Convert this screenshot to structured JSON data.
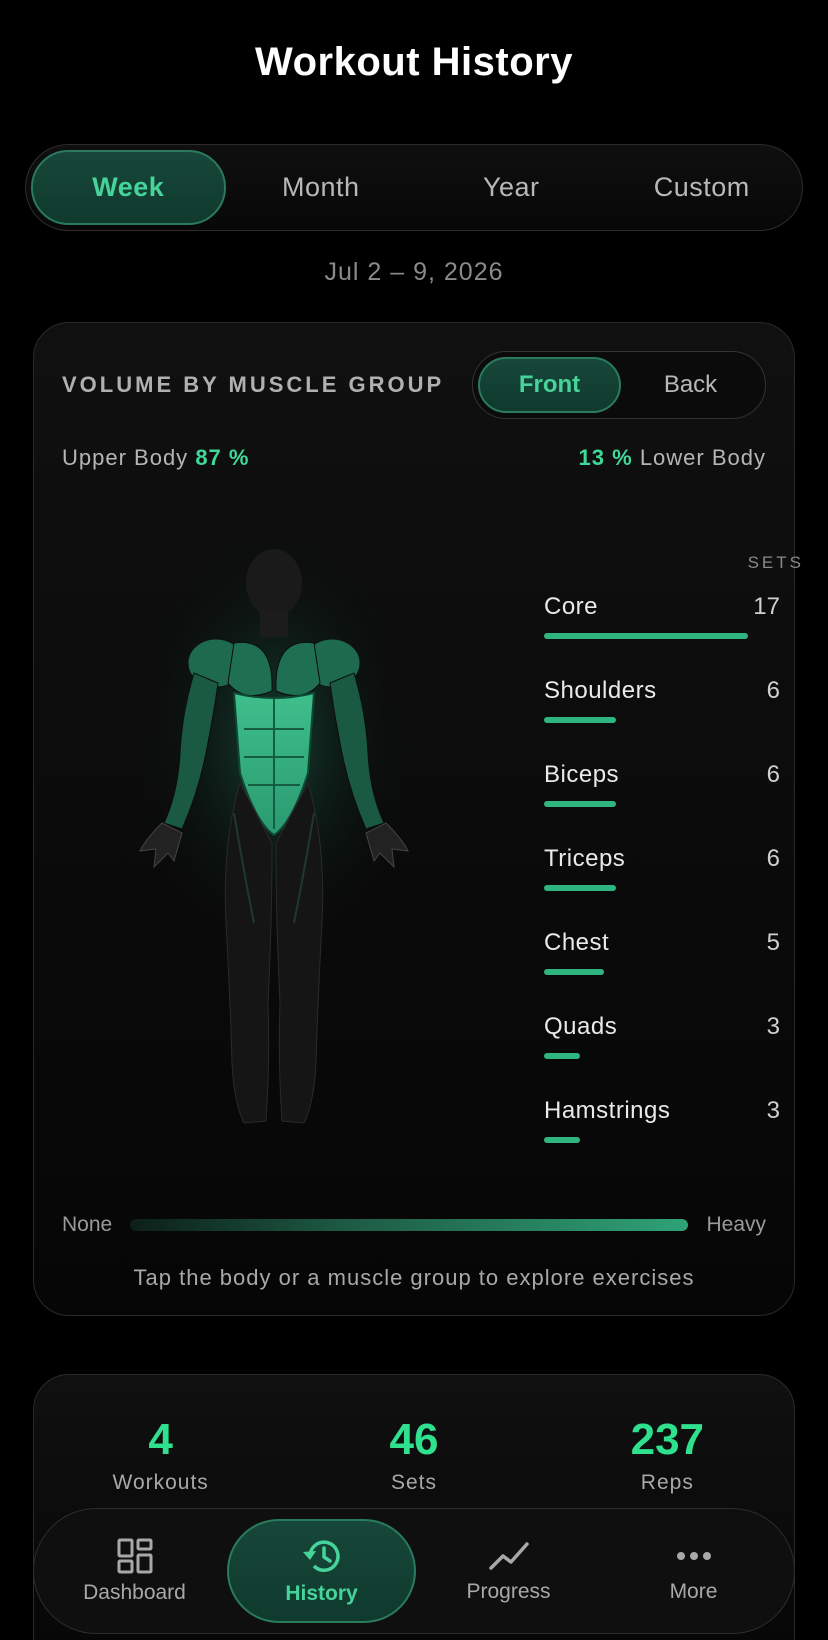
{
  "header": {
    "title": "Workout History"
  },
  "range_tabs": [
    {
      "label": "Week",
      "active": true
    },
    {
      "label": "Month",
      "active": false
    },
    {
      "label": "Year",
      "active": false
    },
    {
      "label": "Custom",
      "active": false
    }
  ],
  "date_range": "Jul 2 – 9, 2026",
  "muscle_card": {
    "title": "VOLUME BY MUSCLE GROUP",
    "view_toggle": {
      "front": "Front",
      "back": "Back",
      "selected": "Front"
    },
    "upper_label": "Upper Body",
    "upper_pct": "87 %",
    "lower_label": "Lower Body",
    "lower_pct": "13 %",
    "sets_header": "SETS",
    "groups": [
      {
        "name": "Core",
        "sets": "17"
      },
      {
        "name": "Shoulders",
        "sets": "6"
      },
      {
        "name": "Biceps",
        "sets": "6"
      },
      {
        "name": "Triceps",
        "sets": "6"
      },
      {
        "name": "Chest",
        "sets": "5"
      },
      {
        "name": "Quads",
        "sets": "3"
      },
      {
        "name": "Hamstrings",
        "sets": "3"
      }
    ],
    "scale_min": "None",
    "scale_max": "Heavy",
    "hint": "Tap the body or a muscle group to explore exercises"
  },
  "summary": {
    "workouts_value": "4",
    "workouts_label": "Workouts",
    "sets_value": "46",
    "sets_label": "Sets",
    "reps_value": "237",
    "reps_label": "Reps"
  },
  "tabbar": [
    {
      "label": "Dashboard",
      "icon": "dashboard-icon",
      "active": false
    },
    {
      "label": "History",
      "icon": "history-icon",
      "active": true
    },
    {
      "label": "Progress",
      "icon": "progress-icon",
      "active": false
    },
    {
      "label": "More",
      "icon": "more-icon",
      "active": false
    }
  ],
  "colors": {
    "accent": "#2fe08e",
    "accent_dark": "#0f3a2d",
    "background": "#000000"
  }
}
